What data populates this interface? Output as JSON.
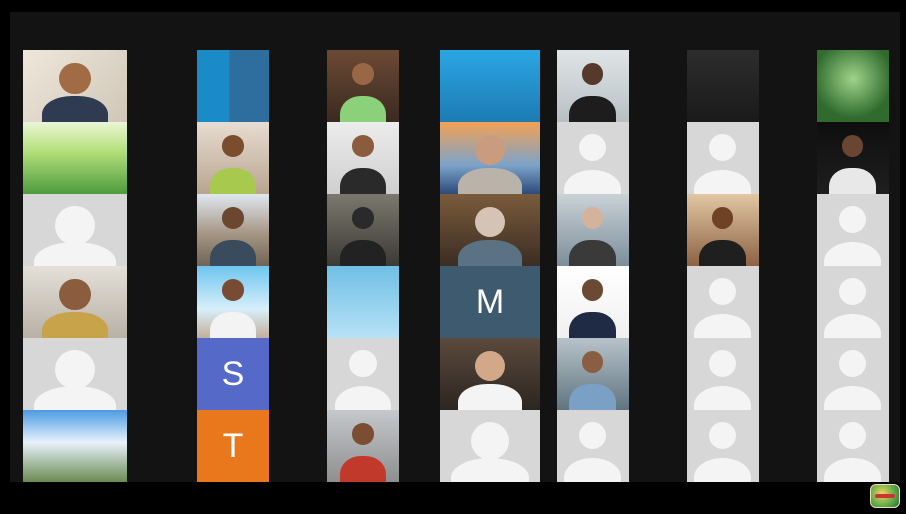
{
  "meeting": {
    "view": "gallery",
    "tiles": [
      {
        "row": 0,
        "col": 0,
        "kind": "video",
        "scene": "man-glasses"
      },
      {
        "row": 0,
        "col": 1,
        "kind": "video",
        "scene": "slides-blue"
      },
      {
        "row": 0,
        "col": 2,
        "kind": "video",
        "scene": "man-green-room"
      },
      {
        "row": 0,
        "col": 3,
        "kind": "video",
        "scene": "slides-cyan"
      },
      {
        "row": 0,
        "col": 4,
        "kind": "video",
        "scene": "dark-room-woman"
      },
      {
        "row": 0,
        "col": 5,
        "kind": "video",
        "scene": "dark-empty"
      },
      {
        "row": 0,
        "col": 6,
        "kind": "video",
        "scene": "forest"
      },
      {
        "row": 1,
        "col": 0,
        "kind": "video",
        "scene": "grass"
      },
      {
        "row": 1,
        "col": 1,
        "kind": "video",
        "scene": "man-green-shirt"
      },
      {
        "row": 1,
        "col": 2,
        "kind": "video",
        "scene": "man-hat"
      },
      {
        "row": 1,
        "col": 3,
        "kind": "video",
        "scene": "woman-hijab-sunset"
      },
      {
        "row": 1,
        "col": 4,
        "kind": "avatar"
      },
      {
        "row": 1,
        "col": 5,
        "kind": "avatar"
      },
      {
        "row": 1,
        "col": 6,
        "kind": "video",
        "scene": "man-dark-bg"
      },
      {
        "row": 2,
        "col": 0,
        "kind": "avatar"
      },
      {
        "row": 2,
        "col": 1,
        "kind": "video",
        "scene": "man-cars"
      },
      {
        "row": 2,
        "col": 2,
        "kind": "video",
        "scene": "dim-room"
      },
      {
        "row": 2,
        "col": 3,
        "kind": "video",
        "scene": "man-cafe"
      },
      {
        "row": 2,
        "col": 4,
        "kind": "video",
        "scene": "woman-sunglasses"
      },
      {
        "row": 2,
        "col": 5,
        "kind": "video",
        "scene": "man-closeup"
      },
      {
        "row": 2,
        "col": 6,
        "kind": "avatar"
      },
      {
        "row": 3,
        "col": 0,
        "kind": "video",
        "scene": "man-batik"
      },
      {
        "row": 3,
        "col": 1,
        "kind": "video",
        "scene": "group-sky"
      },
      {
        "row": 3,
        "col": 2,
        "kind": "video",
        "scene": "monument-sky"
      },
      {
        "row": 3,
        "col": 3,
        "kind": "letter",
        "letter": "M",
        "color": "#3d5a6e"
      },
      {
        "row": 3,
        "col": 4,
        "kind": "video",
        "scene": "man-suit"
      },
      {
        "row": 3,
        "col": 5,
        "kind": "avatar"
      },
      {
        "row": 3,
        "col": 6,
        "kind": "avatar"
      },
      {
        "row": 4,
        "col": 0,
        "kind": "avatar"
      },
      {
        "row": 4,
        "col": 1,
        "kind": "letter",
        "letter": "S",
        "color": "#5569c8"
      },
      {
        "row": 4,
        "col": 2,
        "kind": "avatar"
      },
      {
        "row": 4,
        "col": 3,
        "kind": "video",
        "scene": "woman-white-hijab"
      },
      {
        "row": 4,
        "col": 4,
        "kind": "video",
        "scene": "man-building"
      },
      {
        "row": 4,
        "col": 5,
        "kind": "avatar"
      },
      {
        "row": 4,
        "col": 6,
        "kind": "avatar"
      },
      {
        "row": 5,
        "col": 0,
        "kind": "video",
        "scene": "landscape-sky"
      },
      {
        "row": 5,
        "col": 1,
        "kind": "letter",
        "letter": "T",
        "color": "#e9781c"
      },
      {
        "row": 5,
        "col": 2,
        "kind": "video",
        "scene": "man-red-jacket"
      },
      {
        "row": 5,
        "col": 3,
        "kind": "avatar"
      },
      {
        "row": 5,
        "col": 4,
        "kind": "avatar"
      },
      {
        "row": 5,
        "col": 5,
        "kind": "avatar"
      },
      {
        "row": 5,
        "col": 6,
        "kind": "avatar"
      }
    ]
  },
  "colors": {
    "background": "#000000",
    "frame": "#131313",
    "avatar_bg": "#d7d7d7",
    "avatar_fg": "#f4f4f4"
  },
  "logo": {
    "icon": "event-logo-icon"
  }
}
